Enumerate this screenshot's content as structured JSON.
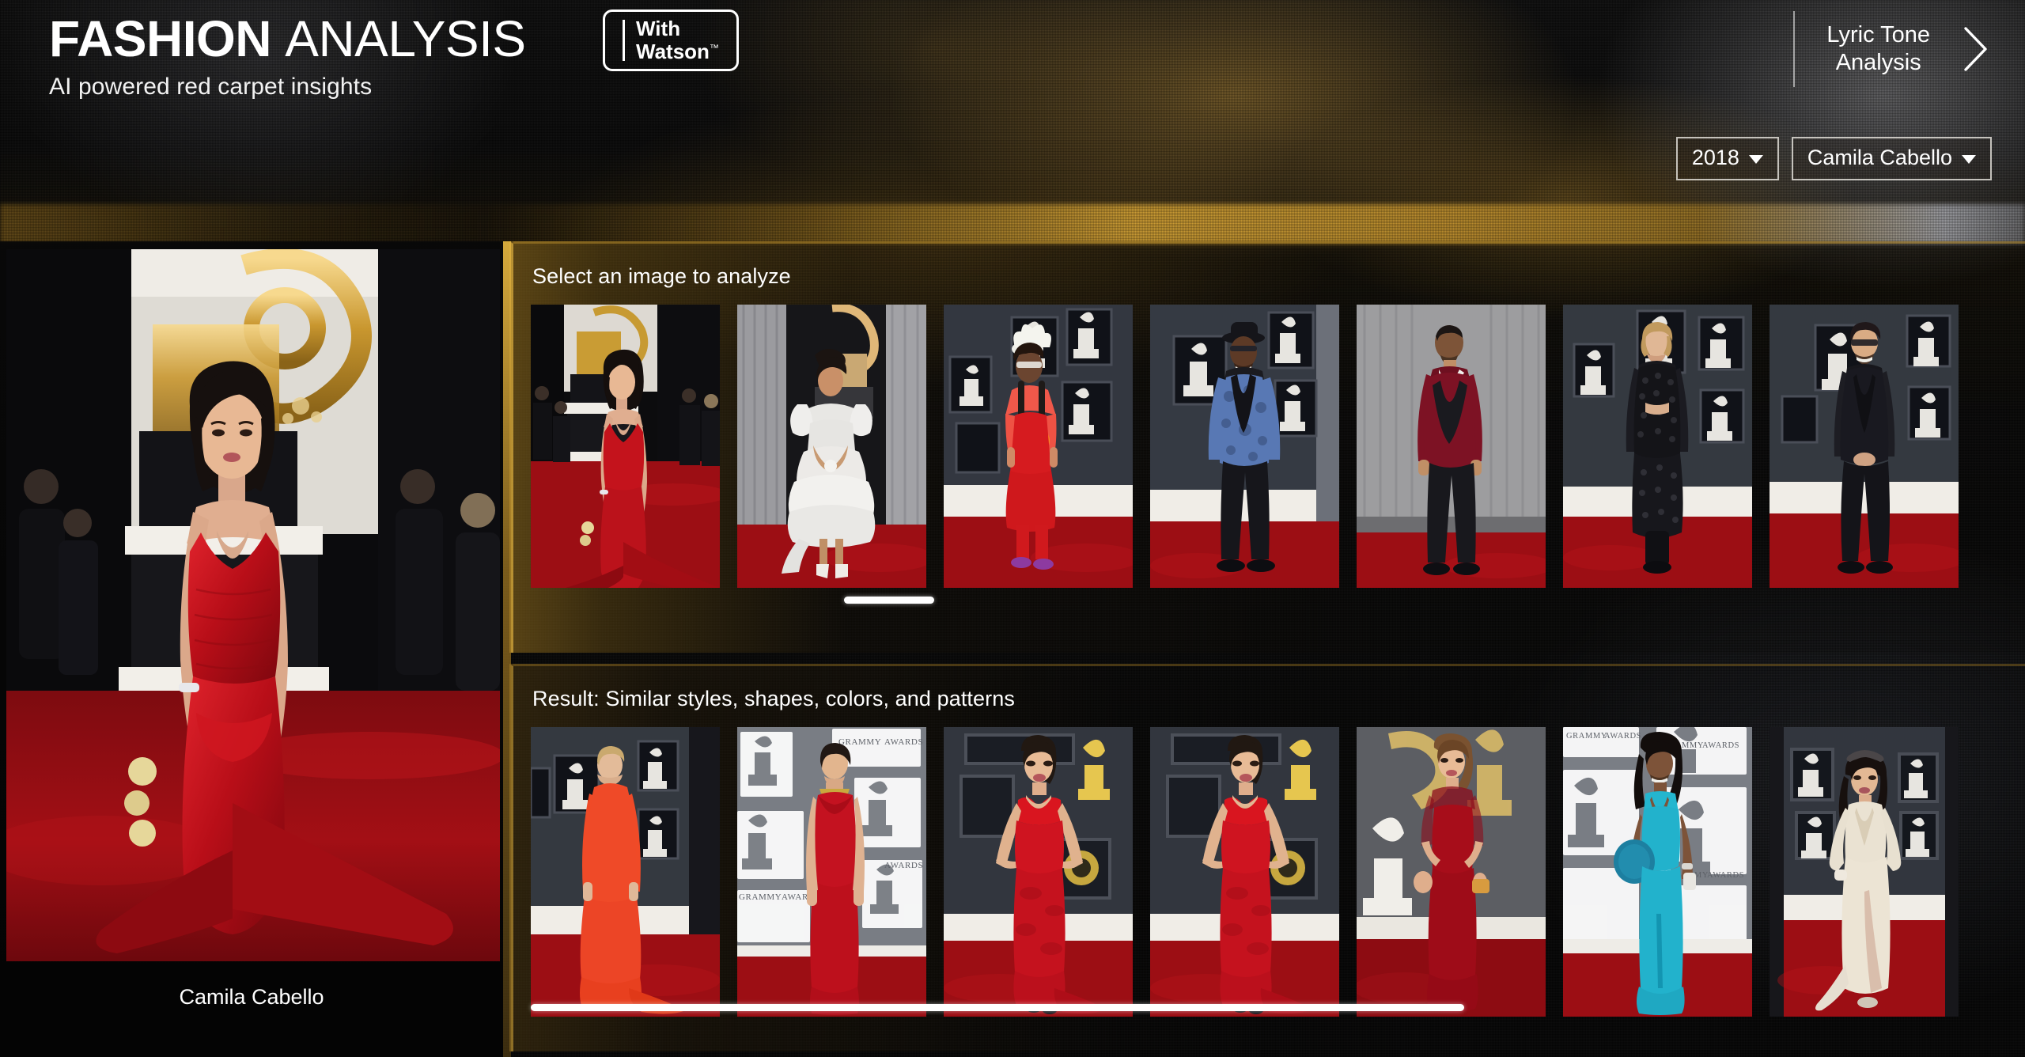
{
  "header": {
    "title_bold": "FASHION",
    "title_light": "ANALYSIS",
    "subtitle": "AI powered red carpet insights",
    "watson_badge_line1": "With",
    "watson_badge_line2": "Watson",
    "watson_badge_tm": "™",
    "right_link_line1": "Lyric Tone",
    "right_link_line2": "Analysis",
    "right_chevron_icon": "chevron-right-icon"
  },
  "filters": {
    "year": {
      "value": "2018",
      "caret_icon": "caret-down-icon"
    },
    "artist": {
      "value": "Camila Cabello",
      "caret_icon": "caret-down-icon"
    }
  },
  "hero": {
    "caption": "Camila Cabello",
    "alt": "Camila Cabello in a strapless red gown on the Grammys red carpet"
  },
  "select_section": {
    "title": "Select an image to analyze",
    "thumbnails": [
      {
        "alt": "Camila Cabello in strapless red gown",
        "selected": true
      },
      {
        "alt": "Woman in white ruffled tiered gown with Grammy statue backdrop",
        "selected": false
      },
      {
        "alt": "Woman in coral red jacket and red jumpsuit with feathered hat",
        "selected": false
      },
      {
        "alt": "Man in blue patterned jacket with black bowler hat",
        "selected": false
      },
      {
        "alt": "Man in burgundy velvet tuxedo with black bow tie",
        "selected": false
      },
      {
        "alt": "Woman in black lace long-sleeve dress and black boots",
        "selected": false
      },
      {
        "alt": "Man in black suit and black shirt with glasses",
        "selected": false
      }
    ]
  },
  "result_section": {
    "title": "Result: Similar styles, shapes, colors, and patterns",
    "thumbnails": [
      {
        "alt": "Woman in orange-red long-sleeve column gown with train"
      },
      {
        "alt": "Woman in red spaghetti-strap gown against Grammy Awards backdrop"
      },
      {
        "alt": "Woman in red strapless sweetheart gown, hands on hips"
      },
      {
        "alt": "Woman in red strapless sweetheart gown, hands on hips"
      },
      {
        "alt": "Woman in dark red gown with sheer lace sleeves and gold clutch"
      },
      {
        "alt": "Woman in turquoise halter gown with blue fur muff"
      },
      {
        "alt": "Woman in cream ivory gown with high slit and headpiece"
      }
    ]
  },
  "scrollbars": {
    "select_label": "select-strip-scrollbar",
    "result_label": "result-strip-scrollbar"
  },
  "colors": {
    "accent_gold": "#d6a83a",
    "text_white": "#ffffff",
    "background_black": "#050505",
    "carpet_red": "#9e0d12",
    "dress_red": "#c41220",
    "turquoise": "#24b6cf"
  }
}
